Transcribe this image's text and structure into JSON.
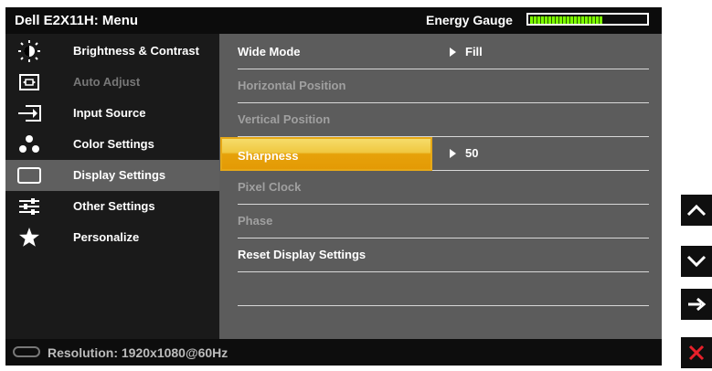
{
  "header": {
    "title": "Dell E2X11H: Menu",
    "energy_label": "Energy Gauge",
    "energy_level": 0.63
  },
  "sidebar": {
    "items": [
      {
        "label": "Brightness & Contrast",
        "icon": "brightness-icon",
        "state": "normal"
      },
      {
        "label": "Auto Adjust",
        "icon": "auto-adjust-icon",
        "state": "disabled"
      },
      {
        "label": "Input Source",
        "icon": "input-source-icon",
        "state": "normal"
      },
      {
        "label": "Color Settings",
        "icon": "color-settings-icon",
        "state": "normal"
      },
      {
        "label": "Display Settings",
        "icon": "display-settings-icon",
        "state": "active"
      },
      {
        "label": "Other Settings",
        "icon": "other-settings-icon",
        "state": "normal"
      },
      {
        "label": "Personalize",
        "icon": "star-icon",
        "state": "normal"
      }
    ]
  },
  "settings": [
    {
      "label": "Wide Mode",
      "value": "Fill",
      "state": "normal"
    },
    {
      "label": "Horizontal Position",
      "value": "",
      "state": "disabled"
    },
    {
      "label": "Vertical Position",
      "value": "",
      "state": "disabled"
    },
    {
      "label": "Sharpness",
      "value": "50",
      "state": "selected"
    },
    {
      "label": "Pixel Clock",
      "value": "",
      "state": "disabled"
    },
    {
      "label": "Phase",
      "value": "",
      "state": "disabled"
    },
    {
      "label": "Reset Display Settings",
      "value": "",
      "state": "normal"
    }
  ],
  "status": {
    "resolution": "Resolution: 1920x1080@60Hz"
  },
  "buttons": [
    {
      "name": "up-arrow-icon",
      "color": "#ffffff"
    },
    {
      "name": "down-arrow-icon",
      "color": "#ffffff"
    },
    {
      "name": "right-arrow-icon",
      "color": "#ffffff"
    },
    {
      "name": "close-icon",
      "color": "#e8202a"
    }
  ],
  "colors": {
    "selection": "#f0b020",
    "active_menu": "#5f5f5f",
    "content_bg": "#5c5c5c",
    "gauge": "#7cff00"
  }
}
